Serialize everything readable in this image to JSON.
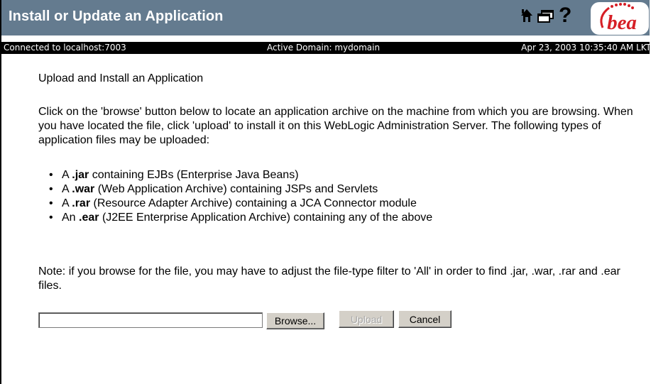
{
  "header": {
    "title": "Install or Update an Application",
    "logo_text": "bea",
    "help_glyph": "?",
    "icons": [
      "home-icon",
      "window-icon",
      "help-icon",
      "bea-logo"
    ],
    "colors": {
      "titlebar": "#647b8f",
      "statusbar": "#000000",
      "logo_red": "#d61f26"
    }
  },
  "status": {
    "connection": "Connected to localhost:7003",
    "domain": "Active Domain: mydomain",
    "datetime": "Apr 23, 2003 10:35:40 AM LKT"
  },
  "main": {
    "heading": "Upload and Install an Application",
    "intro": "Click on the 'browse' button below to locate an application archive on the machine from which you are browsing. When you have located the file, click 'upload' to install it on this WebLogic Administration Server. The following types of application files may be uploaded:",
    "file_types": [
      {
        "article": "A",
        "ext": ".jar",
        "desc": "containing EJBs (Enterprise Java Beans)"
      },
      {
        "article": "A",
        "ext": ".war",
        "desc": "(Web Application Archive) containing JSPs and Servlets"
      },
      {
        "article": "A",
        "ext": ".rar",
        "desc": "(Resource Adapter Archive) containing a JCA Connector module"
      },
      {
        "article": "An",
        "ext": ".ear",
        "desc": "(J2EE Enterprise Application Archive) containing any of the above"
      }
    ],
    "note": "Note: if you browse for the file, you may have to adjust the file-type filter to 'All' in order to find .jar, .war, .rar and .ear files."
  },
  "form": {
    "file_value": "",
    "browse_label": "Browse...",
    "upload_label": "Upload",
    "cancel_label": "Cancel"
  }
}
